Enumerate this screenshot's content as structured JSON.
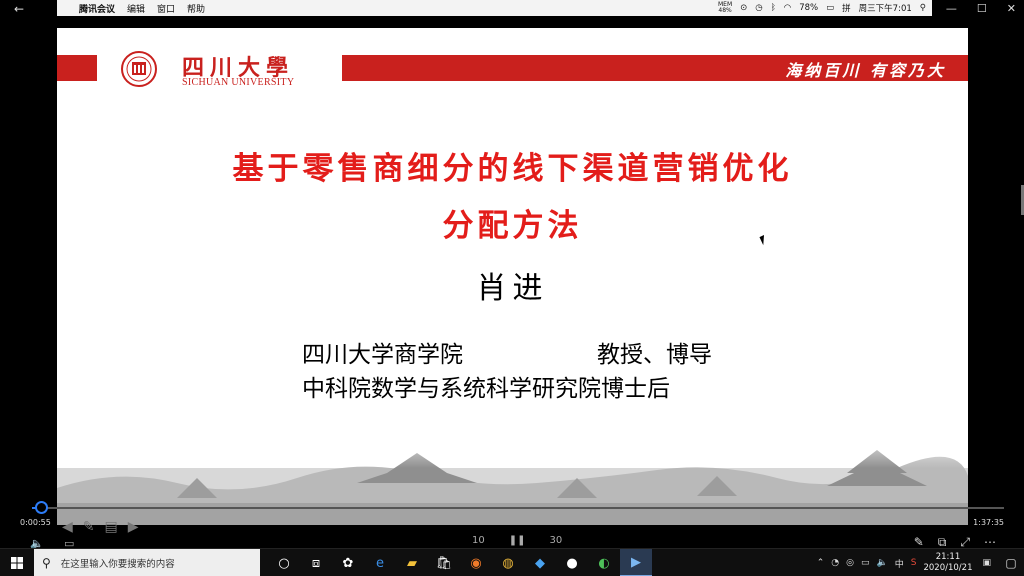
{
  "menubar": {
    "items": [
      "腾讯会议",
      "编辑",
      "窗口",
      "帮助"
    ],
    "mem_label": "MEM",
    "mem_value": "48%",
    "battery": "78%",
    "datetime": "周三下午7:01"
  },
  "slide": {
    "university_cn": "四川大學",
    "university_en": "SICHUAN UNIVERSITY",
    "motto": "海纳百川 有容乃大",
    "title_line1": "基于零售商细分的线下渠道营销优化",
    "title_line2": "分配方法",
    "author": "肖进",
    "affiliation1": "四川大学商学院",
    "position": "教授、博导",
    "affiliation2": "中科院数学与系统科学研究院博士后"
  },
  "player": {
    "current_time": "0:00:55",
    "total_time": "1:37:35",
    "progress": 0.0094,
    "skip_back": "10",
    "skip_fwd": "30"
  },
  "taskbar": {
    "search_placeholder": "在这里输入你要搜索的内容",
    "ime": "中",
    "time": "21:11",
    "date": "2020/10/21"
  },
  "colors": {
    "sichuan_red": "#c9211e",
    "title_red": "#e31d1a",
    "progress_blue": "#2d7cf6"
  }
}
